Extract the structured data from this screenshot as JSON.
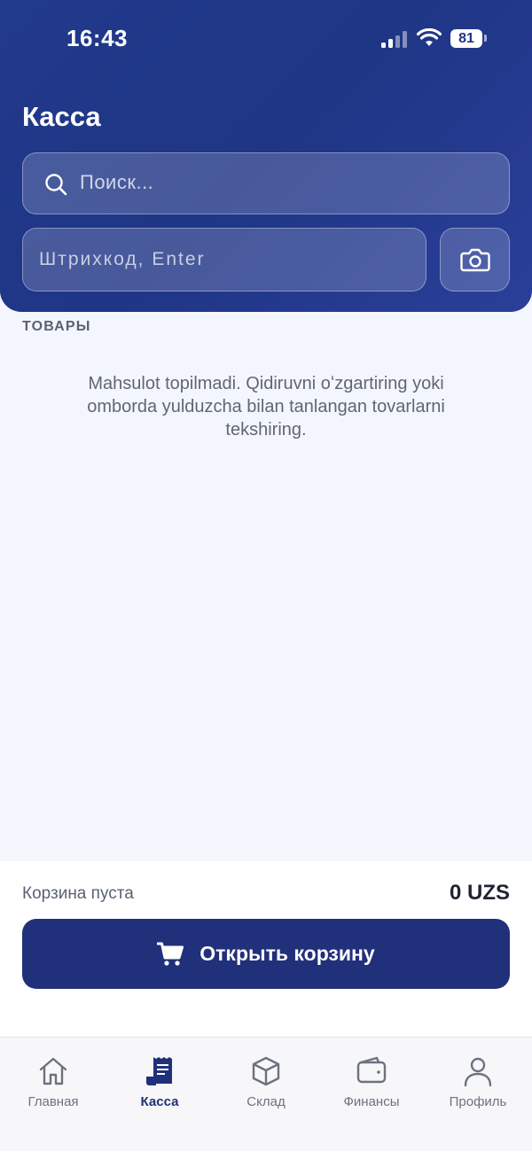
{
  "status_bar": {
    "time": "16:43",
    "battery": "81"
  },
  "header": {
    "title": "Касса",
    "search_placeholder": "Поиск...",
    "barcode_placeholder": "Штрихкод, Enter"
  },
  "products": {
    "section_label": "ТОВАРЫ",
    "empty_message": "Mahsulot topilmadi. Qidiruvni oʻzgartiring yoki omborda yulduzcha bilan tanlangan tovarlarni tekshiring."
  },
  "cart": {
    "status": "Корзина пуста",
    "total": "0 UZS",
    "open_button_label": "Открыть корзину"
  },
  "tabs": [
    {
      "label": "Главная",
      "icon": "home-icon",
      "active": false
    },
    {
      "label": "Касса",
      "icon": "receipt-icon",
      "active": true
    },
    {
      "label": "Склад",
      "icon": "box-icon",
      "active": false
    },
    {
      "label": "Финансы",
      "icon": "wallet-icon",
      "active": false
    },
    {
      "label": "Профиль",
      "icon": "user-icon",
      "active": false
    }
  ],
  "colors": {
    "header": "#223a8c",
    "primary_button": "#21307a",
    "background": "#f4f6fd"
  }
}
